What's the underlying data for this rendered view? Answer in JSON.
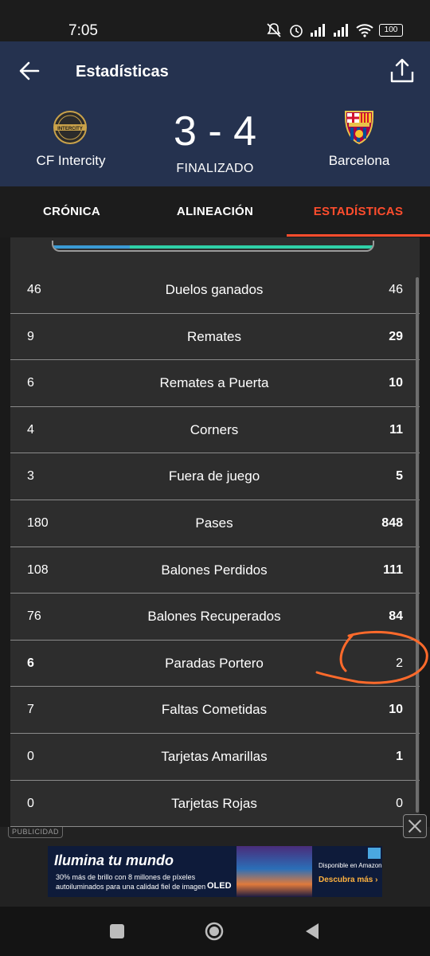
{
  "status_bar": {
    "time": "7:05",
    "battery": "100"
  },
  "header": {
    "title": "Estadísticas",
    "back_icon": "arrow-left-icon",
    "share_icon": "share-icon"
  },
  "match": {
    "home_team": "CF Intercity",
    "away_team": "Barcelona",
    "score": "3 - 4",
    "status": "FINALIZADO",
    "home_crest_text": "INTERCITY",
    "away_crest_text": "FCB"
  },
  "tabs": [
    {
      "label": "CRÓNICA",
      "active": false
    },
    {
      "label": "ALINEACIÓN",
      "active": false
    },
    {
      "label": "ESTADÍSTICAS",
      "active": true
    }
  ],
  "colors": {
    "accent": "#ff4d2d",
    "header_bg": "#25324f",
    "home_bar": "#3a9bd5",
    "away_bar": "#2fd1a8"
  },
  "stats": [
    {
      "home": "46",
      "label": "Duelos ganados",
      "away": "46",
      "home_bold": false,
      "away_bold": false
    },
    {
      "home": "9",
      "label": "Remates",
      "away": "29",
      "home_bold": false,
      "away_bold": true
    },
    {
      "home": "6",
      "label": "Remates a Puerta",
      "away": "10",
      "home_bold": false,
      "away_bold": true
    },
    {
      "home": "4",
      "label": "Corners",
      "away": "11",
      "home_bold": false,
      "away_bold": true
    },
    {
      "home": "3",
      "label": "Fuera de juego",
      "away": "5",
      "home_bold": false,
      "away_bold": true
    },
    {
      "home": "180",
      "label": "Pases",
      "away": "848",
      "home_bold": false,
      "away_bold": true
    },
    {
      "home": "108",
      "label": "Balones Perdidos",
      "away": "111",
      "home_bold": false,
      "away_bold": true
    },
    {
      "home": "76",
      "label": "Balones Recuperados",
      "away": "84",
      "home_bold": false,
      "away_bold": true
    },
    {
      "home": "6",
      "label": "Paradas Portero",
      "away": "2",
      "home_bold": true,
      "away_bold": false
    },
    {
      "home": "7",
      "label": "Faltas Cometidas",
      "away": "10",
      "home_bold": false,
      "away_bold": true
    },
    {
      "home": "0",
      "label": "Tarjetas Amarillas",
      "away": "1",
      "home_bold": false,
      "away_bold": true
    },
    {
      "home": "0",
      "label": "Tarjetas Rojas",
      "away": "0",
      "home_bold": false,
      "away_bold": false
    }
  ],
  "ad": {
    "label": "PUBLICIDAD",
    "headline": "Ilumina tu mundo",
    "body": "30% más de brillo con 8 millones de píxeles autoiluminados para una calidad fiel de imagen",
    "brand": "OLED",
    "availability": "Disponible en Amazon",
    "cta": "Descubra más ›"
  }
}
